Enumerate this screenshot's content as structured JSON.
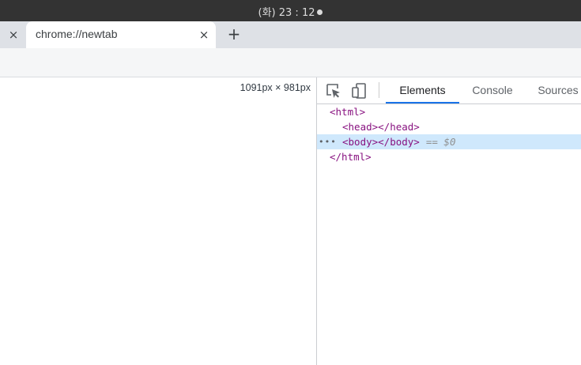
{
  "os": {
    "clock": "(화) 23 : 12"
  },
  "tabs": {
    "prev_close": "×",
    "active_title": "chrome://newtab",
    "close": "×",
    "new_tab": "+"
  },
  "viewport": {
    "dimensions": "1091px × 981px"
  },
  "devtools": {
    "tabs": [
      {
        "label": "Elements",
        "active": true
      },
      {
        "label": "Console",
        "active": false
      },
      {
        "label": "Sources",
        "active": false
      }
    ],
    "dom": {
      "html_open": "<html>",
      "head": "<head></head>",
      "body": "<body></body>",
      "selected_hint": "== $0",
      "html_close": "</html>",
      "ellipsis": "•••"
    },
    "accent": "#1a73e8",
    "tag_color": "#881280",
    "selected_row_color": "#cfe8fc"
  },
  "icons": [
    "inspect-element-icon",
    "device-toolbar-icon"
  ]
}
